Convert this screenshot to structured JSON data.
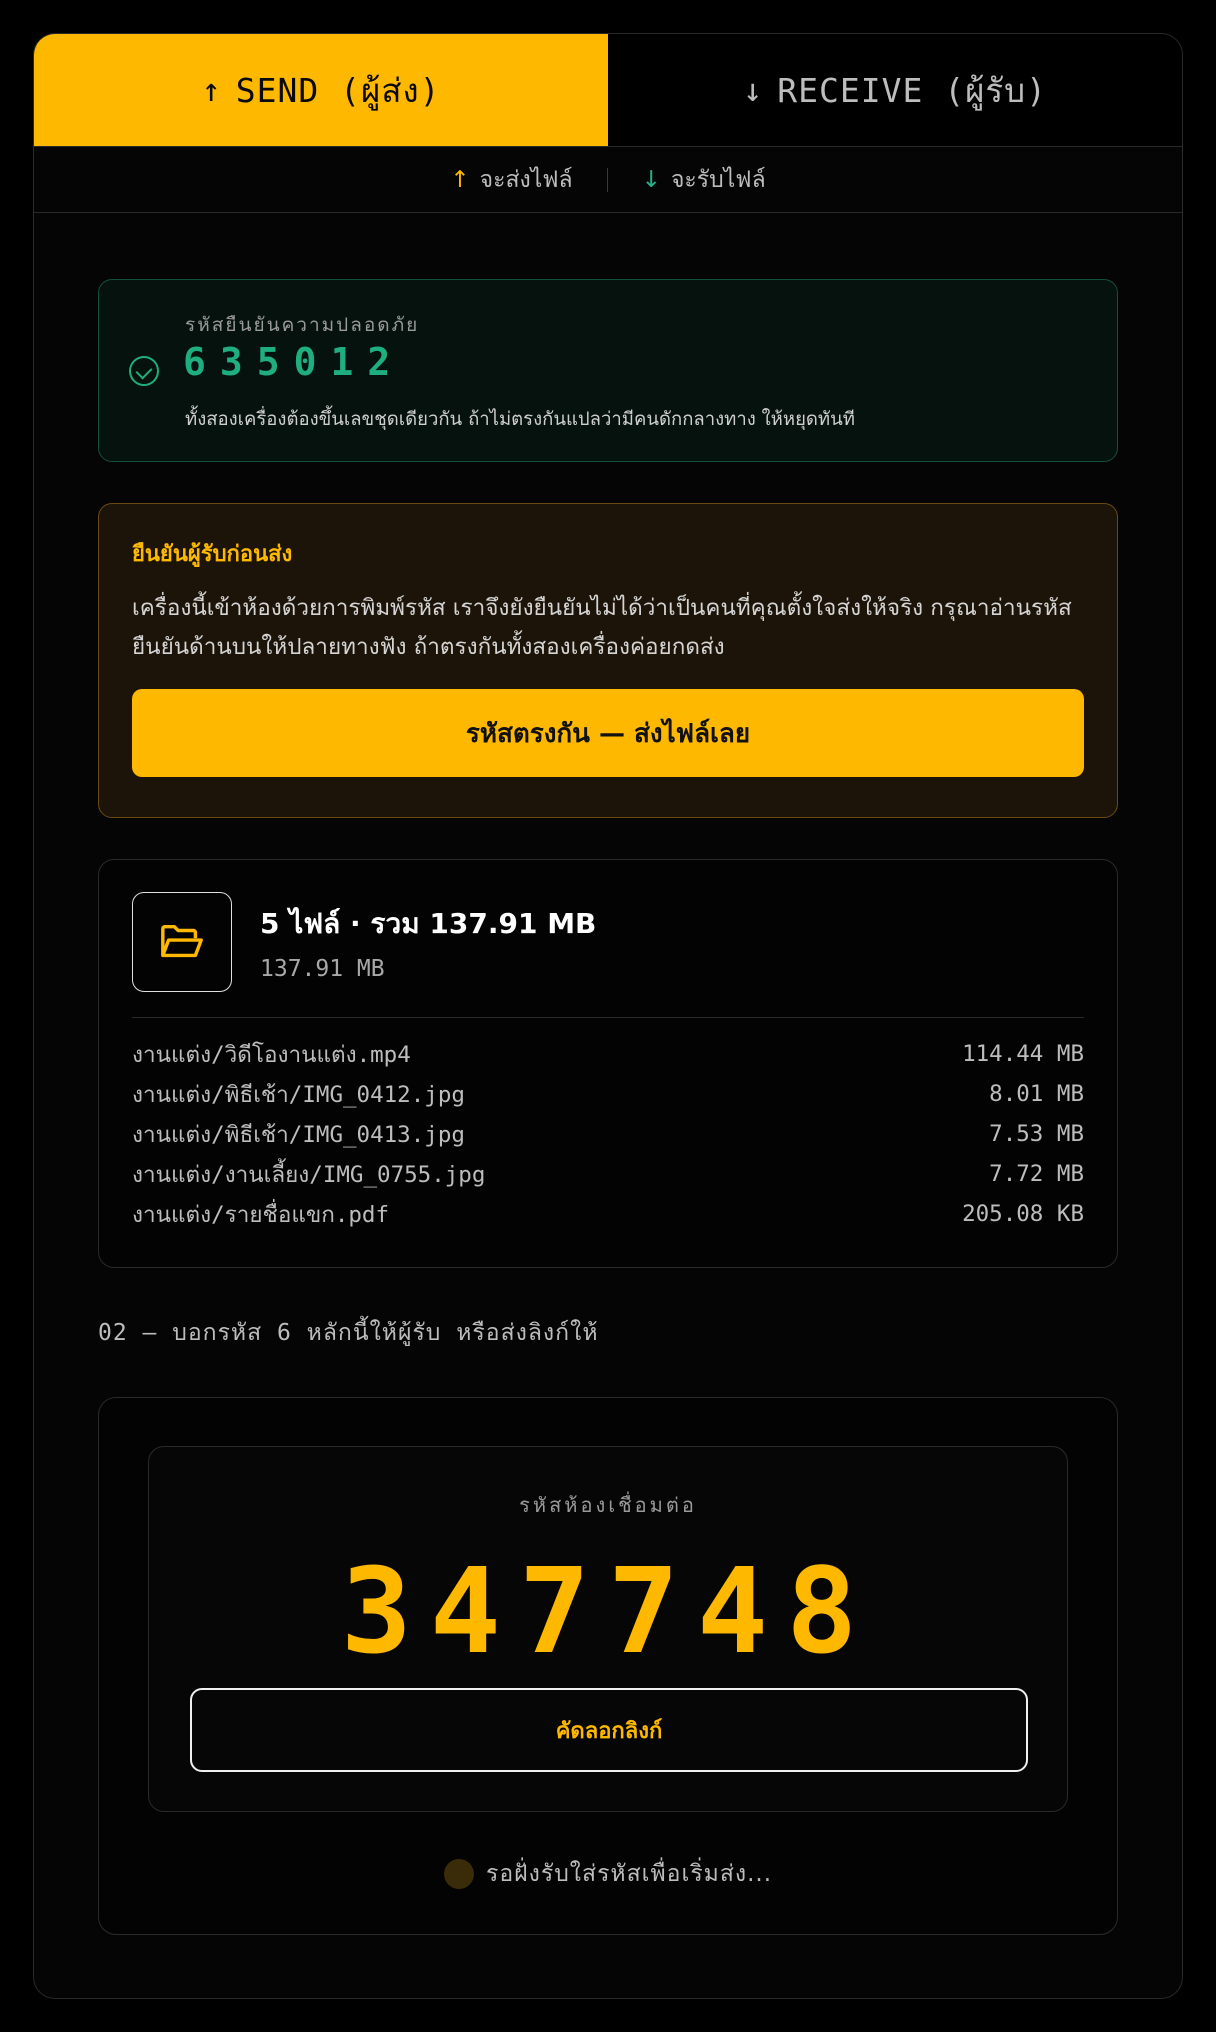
{
  "tabs": {
    "send": {
      "arrow": "↑",
      "label": "SEND (ผู้ส่ง)"
    },
    "receive": {
      "arrow": "↓",
      "label": "RECEIVE (ผู้รับ)"
    }
  },
  "subbar": {
    "send": {
      "arrow": "↑",
      "label": "จะส่งไฟล์"
    },
    "receive": {
      "arrow": "↓",
      "label": "จะรับไฟล์"
    }
  },
  "verify": {
    "label": "รหัสยืนยันความปลอดภัย",
    "code": "635012",
    "note": "ทั้งสองเครื่องต้องขึ้นเลขชุดเดียวกัน ถ้าไม่ตรงกันแปลว่ามีคนดักกลางทาง ให้หยุดทันที"
  },
  "confirm": {
    "title": "ยืนยันผู้รับก่อนส่ง",
    "body": "เครื่องนี้เข้าห้องด้วยการพิมพ์รหัส เราจึงยังยืนยันไม่ได้ว่าเป็นคนที่คุณตั้งใจส่งให้จริง กรุณาอ่านรหัสยืนยันด้านบนให้ปลายทางฟัง ถ้าตรงกันทั้งสองเครื่องค่อยกดส่ง",
    "button": "รหัสตรงกัน — ส่งไฟล์เลย"
  },
  "files": {
    "summary": "5 ไฟล์ · รวม 137.91 MB",
    "size": "137.91 MB",
    "items": [
      {
        "name": "งานแต่ง/วิดีโองานแต่ง.mp4",
        "size": "114.44 MB"
      },
      {
        "name": "งานแต่ง/พิธีเช้า/IMG_0412.jpg",
        "size": "8.01 MB"
      },
      {
        "name": "งานแต่ง/พิธีเช้า/IMG_0413.jpg",
        "size": "7.53 MB"
      },
      {
        "name": "งานแต่ง/งานเลี้ยง/IMG_0755.jpg",
        "size": "7.72 MB"
      },
      {
        "name": "งานแต่ง/รายชื่อแขก.pdf",
        "size": "205.08 KB"
      }
    ]
  },
  "step": "02 — บอกรหัส 6 หลักนี้ให้ผู้รับ หรือส่งลิงก์ให้",
  "room": {
    "label": "รหัสห้องเชื่อมต่อ",
    "code": "347748",
    "copy_button": "คัดลอกลิงก์",
    "status": "รอฝั่งรับใส่รหัสเพื่อเริ่มส่ง..."
  },
  "colors": {
    "accent": "#FFB800",
    "success": "#1fae80"
  },
  "icons": {
    "folder": "folder-open-icon",
    "check": "check-circle-icon"
  }
}
